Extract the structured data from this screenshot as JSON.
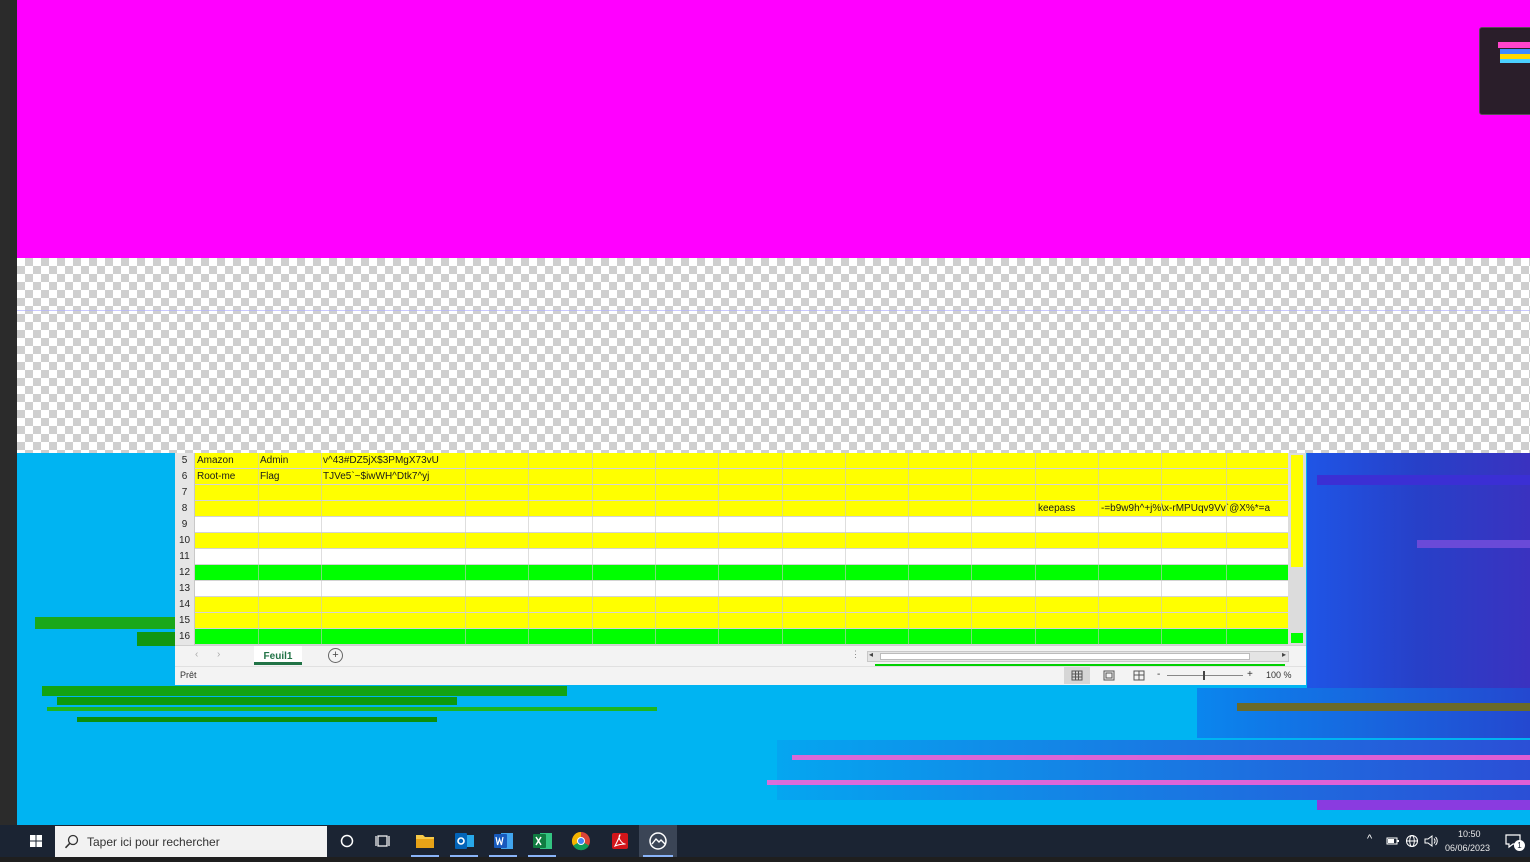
{
  "excel": {
    "rows": [
      {
        "num": "5",
        "fill": "#ffff00",
        "a": "Amazon",
        "b": "Admin",
        "c": "v^43#DZ5jX$3PMgX73vU",
        "k": "",
        "l": ""
      },
      {
        "num": "6",
        "fill": "#ffff00",
        "a": "Root-me",
        "b": "Flag",
        "c": "TJVe5`~$iwWH^Dtk7^yj",
        "k": "",
        "l": ""
      },
      {
        "num": "7",
        "fill": "#ffff00",
        "a": "",
        "b": "",
        "c": "",
        "k": "",
        "l": ""
      },
      {
        "num": "8",
        "fill": "#ffff00",
        "a": "",
        "b": "",
        "c": "",
        "k": "keepass",
        "l": "-=b9w9h^+j%\\x-rMPUqv9Vv`@X%*=a"
      },
      {
        "num": "9",
        "fill": "#ffffff",
        "a": "",
        "b": "",
        "c": "",
        "k": "",
        "l": ""
      },
      {
        "num": "10",
        "fill": "#ffff00",
        "a": "",
        "b": "",
        "c": "",
        "k": "",
        "l": ""
      },
      {
        "num": "11",
        "fill": "#ffffff",
        "a": "",
        "b": "",
        "c": "",
        "k": "",
        "l": ""
      },
      {
        "num": "12",
        "fill": "#00ff00",
        "a": "",
        "b": "",
        "c": "",
        "k": "",
        "l": ""
      },
      {
        "num": "13",
        "fill": "#ffffff",
        "a": "",
        "b": "",
        "c": "",
        "k": "",
        "l": ""
      },
      {
        "num": "14",
        "fill": "#ffff00",
        "a": "",
        "b": "",
        "c": "",
        "k": "",
        "l": ""
      },
      {
        "num": "15",
        "fill": "#ffff00",
        "a": "",
        "b": "",
        "c": "",
        "k": "",
        "l": ""
      },
      {
        "num": "16",
        "fill": "#00ff00",
        "a": "",
        "b": "",
        "c": "",
        "k": "",
        "l": ""
      }
    ],
    "sheet_tab": "Feuil1",
    "status": "Prêt",
    "zoom": "100 %",
    "zoom_minus": "-",
    "zoom_plus": "+"
  },
  "taskbar": {
    "search_placeholder": "Taper ici pour rechercher",
    "time": "10:50",
    "date": "06/06/2023",
    "notification_count": "1"
  },
  "colors": {
    "magenta": "#ff00ff",
    "desktop": "#00b4f2",
    "excel_green": "#217346",
    "taskbar": "#1b2433"
  }
}
